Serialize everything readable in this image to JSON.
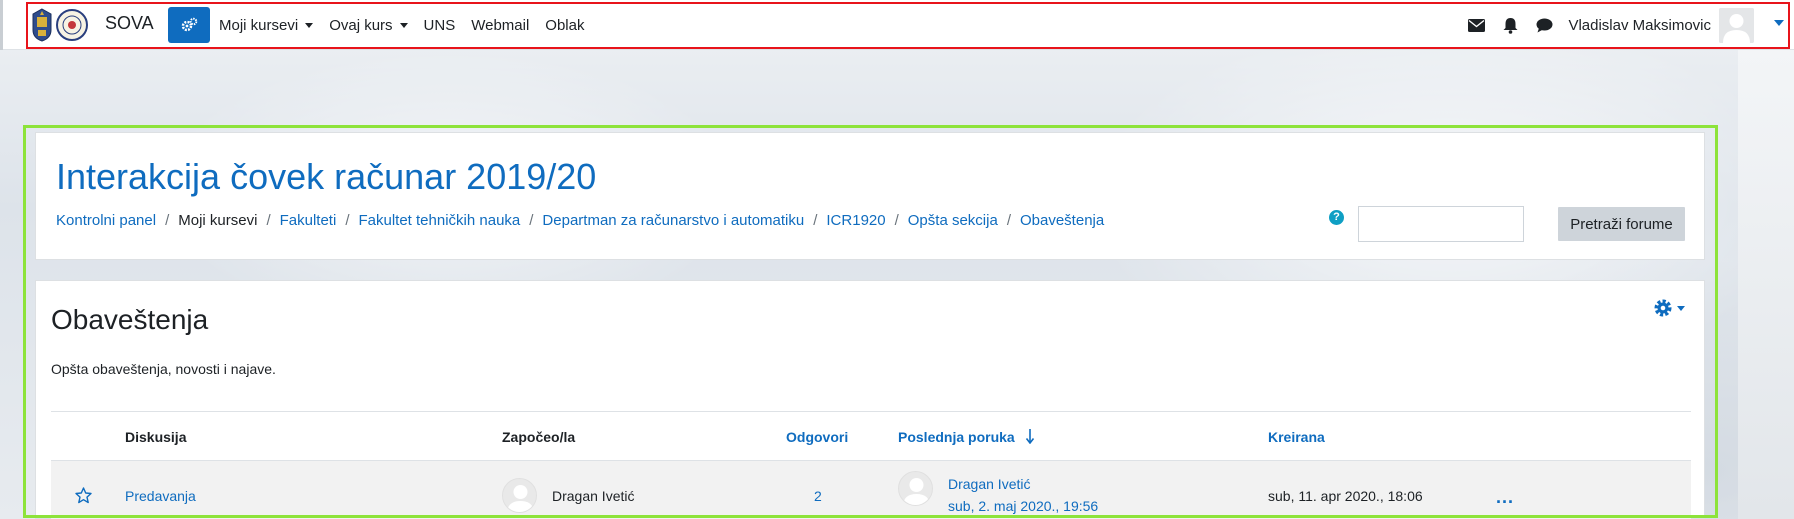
{
  "navbar": {
    "brand": "SOVA",
    "links": [
      {
        "label": "Moji kursevi",
        "dropdown": true
      },
      {
        "label": "Ovaj kurs",
        "dropdown": true
      },
      {
        "label": "UNS",
        "dropdown": false
      },
      {
        "label": "Webmail",
        "dropdown": false
      },
      {
        "label": "Oblak",
        "dropdown": false
      }
    ],
    "icons": [
      "envelope-icon",
      "bell-icon",
      "chat-bubble-icon"
    ],
    "user_name": "Vladislav Maksimovic",
    "accent": "#0f6cbf"
  },
  "header": {
    "course_title": "Interakcija čovek računar 2019/20",
    "breadcrumb": [
      {
        "label": "Kontrolni panel",
        "link": true
      },
      {
        "label": "Moji kursevi",
        "link": false
      },
      {
        "label": "Fakulteti",
        "link": true
      },
      {
        "label": "Fakultet tehničkih nauka",
        "link": true
      },
      {
        "label": "Departman za računarstvo i automatiku",
        "link": true
      },
      {
        "label": "ICR1920",
        "link": true
      },
      {
        "label": "Opšta sekcija",
        "link": true
      },
      {
        "label": "Obaveštenja",
        "link": true
      }
    ],
    "search": {
      "value": "",
      "placeholder": "",
      "button_label": "Pretraži forume"
    }
  },
  "forum": {
    "title": "Obaveštenja",
    "description": "Opšta obaveštenja, novosti i najave.",
    "columns": {
      "discussion": "Diskusija",
      "started_by": "Započeo/la",
      "replies": "Odgovori",
      "last_post": "Poslednja poruka",
      "created": "Kreirana"
    },
    "rows": [
      {
        "discussion": "Predavanja",
        "started_by": "Dragan Ivetić",
        "replies": "2",
        "last_post_author": "Dragan Ivetić",
        "last_post_date": "sub, 2. maj 2020., 19:56",
        "created": "sub, 11. apr 2020., 18:06",
        "more": "..."
      }
    ]
  }
}
